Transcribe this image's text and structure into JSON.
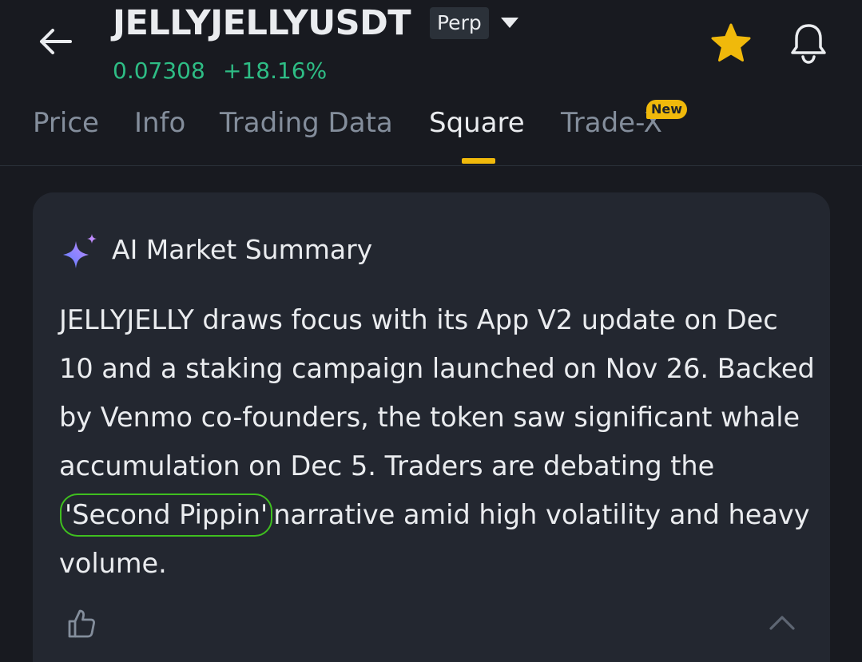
{
  "header": {
    "symbol": "JELLYJELLYUSDT",
    "contract_type": "Perp",
    "price": "0.07308",
    "change": "+18.16%",
    "colors": {
      "up": "#2ebd85",
      "accent": "#f0b90b"
    },
    "icons": {
      "back": "arrow-left-icon",
      "dropdown": "caret-down-icon",
      "favorite": "star-icon",
      "alerts": "bell-icon"
    }
  },
  "tabs": [
    {
      "label": "Price"
    },
    {
      "label": "Info"
    },
    {
      "label": "Trading Data"
    },
    {
      "label": "Square",
      "active": true
    },
    {
      "label": "Trade-X",
      "badge": "New"
    }
  ],
  "card": {
    "title": "AI Market Summary",
    "summary_before": "JELLYJELLY draws focus with its App V2 update on Dec 10 and a staking campaign launched on Nov 26. Backed by Venmo co-founders, the token saw significant whale accumulation on Dec 5. Traders are debating the",
    "summary_highlight": "'Second Pippin'",
    "summary_after": "narrative amid high volatility and heavy volume.",
    "icons": {
      "title": "sparkle-icon",
      "like": "thumbs-up-icon",
      "collapse": "chevron-up-icon"
    }
  }
}
